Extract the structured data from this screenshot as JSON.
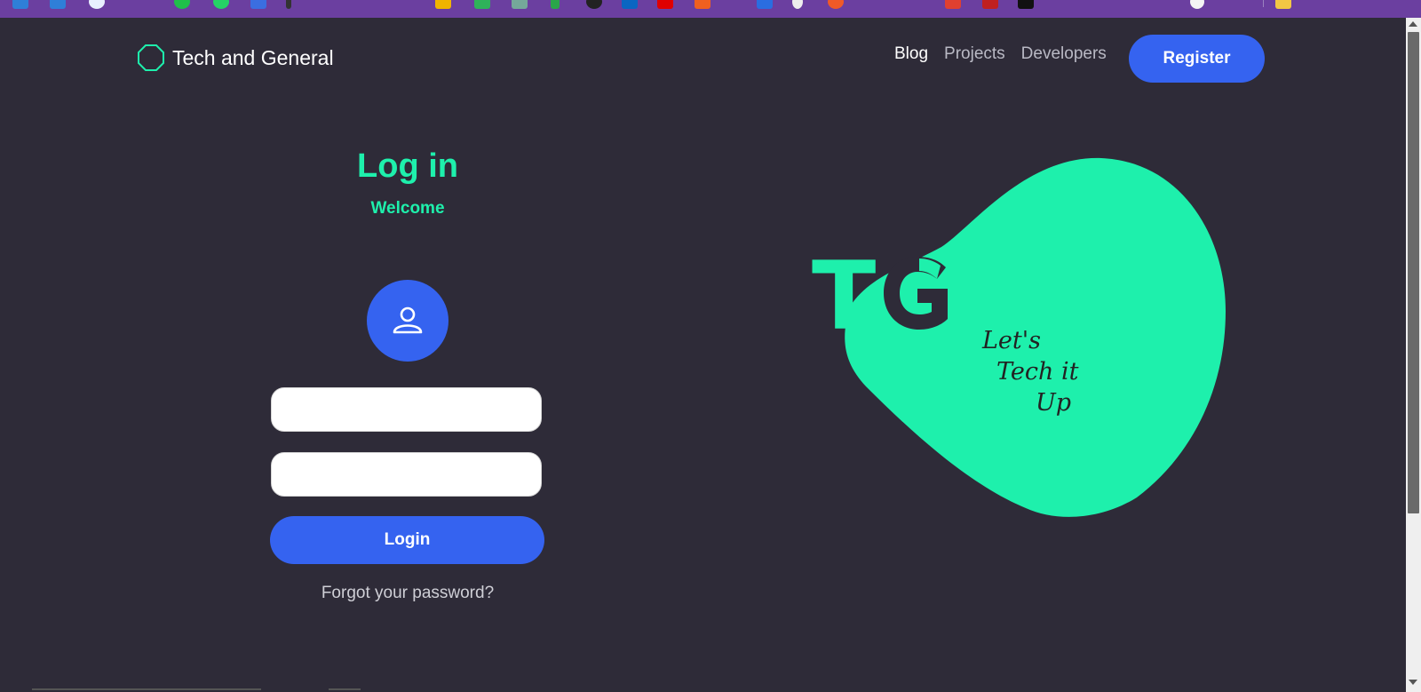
{
  "brand": {
    "name": "Tech and General"
  },
  "nav": {
    "links": [
      "Blog",
      "Projects",
      "Developers"
    ],
    "register": "Register"
  },
  "login": {
    "title": "Log in",
    "subtitle": "Welcome",
    "button": "Login",
    "forgot": "Forgot your password?",
    "username_value": "",
    "password_value": ""
  },
  "art": {
    "letter1": "T",
    "letter2": "G",
    "tagline": [
      "Let's",
      "Tech it",
      "Up"
    ]
  },
  "colors": {
    "accent": "#1ef0ac",
    "primary": "#3563f0",
    "background": "#2e2b38",
    "browser_bar": "#6b3fa0"
  },
  "icons": {
    "brand": "octagon-icon",
    "avatar": "user-icon"
  }
}
